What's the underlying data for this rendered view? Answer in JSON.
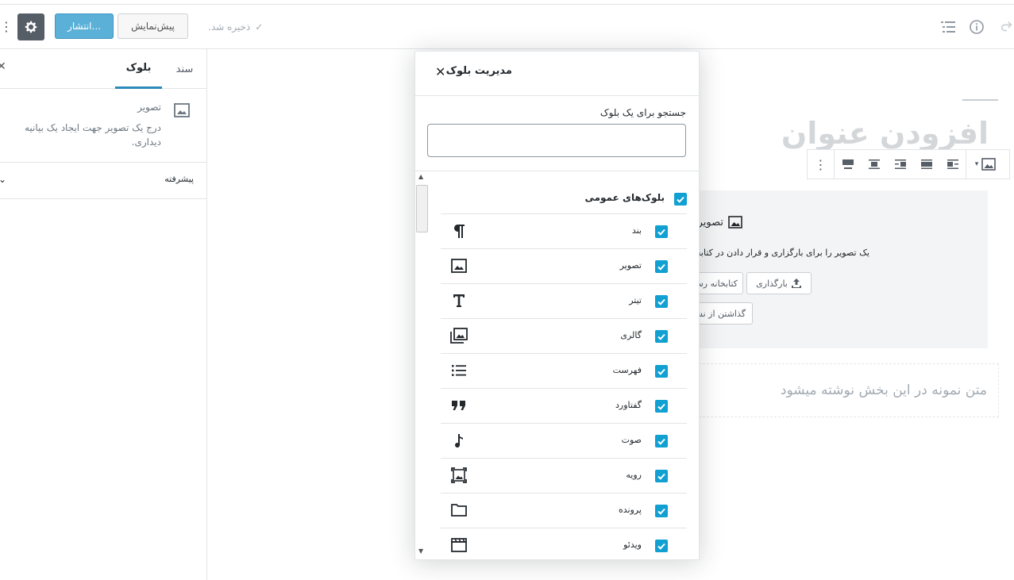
{
  "header": {
    "publish_label": "انتشار...",
    "preview_label": "پیش‌نمایش",
    "saved_label": "ذخیره شد."
  },
  "sidebar": {
    "tab_block": "بلوک",
    "tab_document": "سند",
    "card_title": "تصویر",
    "card_description": "درج یک تصویر جهت ایجاد یک بیانیه دیداری.",
    "advanced_label": "پیشرفته"
  },
  "editor": {
    "title_placeholder": "افزودن عنوان",
    "image_block_title": "تصویر",
    "image_block_description": "یک تصویر را برای بارگزاری و قرار دادن در کتابخانه",
    "upload_label": "بارگذاری",
    "library_label": "کتابخانه رسانه",
    "url_label": "گذاشتن از نشانی",
    "paragraph_placeholder": "متن نمونه در این بخش نوشته میشود"
  },
  "modal": {
    "title": "مدیریت بلوک",
    "search_label": "جستجو برای یک بلوک",
    "search_value": "",
    "search_placeholder": "",
    "group_label": "بلوک‌های عمومی",
    "items": [
      {
        "label": "بند",
        "icon": "paragraph-icon"
      },
      {
        "label": "تصویر",
        "icon": "image-icon"
      },
      {
        "label": "تیتر",
        "icon": "heading-icon"
      },
      {
        "label": "گالری",
        "icon": "gallery-icon"
      },
      {
        "label": "فهرست",
        "icon": "list-icon"
      },
      {
        "label": "گفتاورد",
        "icon": "quote-icon"
      },
      {
        "label": "صوت",
        "icon": "audio-icon"
      },
      {
        "label": "رویه",
        "icon": "cover-icon"
      },
      {
        "label": "پرونده",
        "icon": "file-icon"
      },
      {
        "label": "ویدئو",
        "icon": "video-icon"
      }
    ]
  },
  "colors": {
    "accent": "#11a0d2",
    "publish": "#5ab0d7",
    "gear": "#555d66"
  }
}
